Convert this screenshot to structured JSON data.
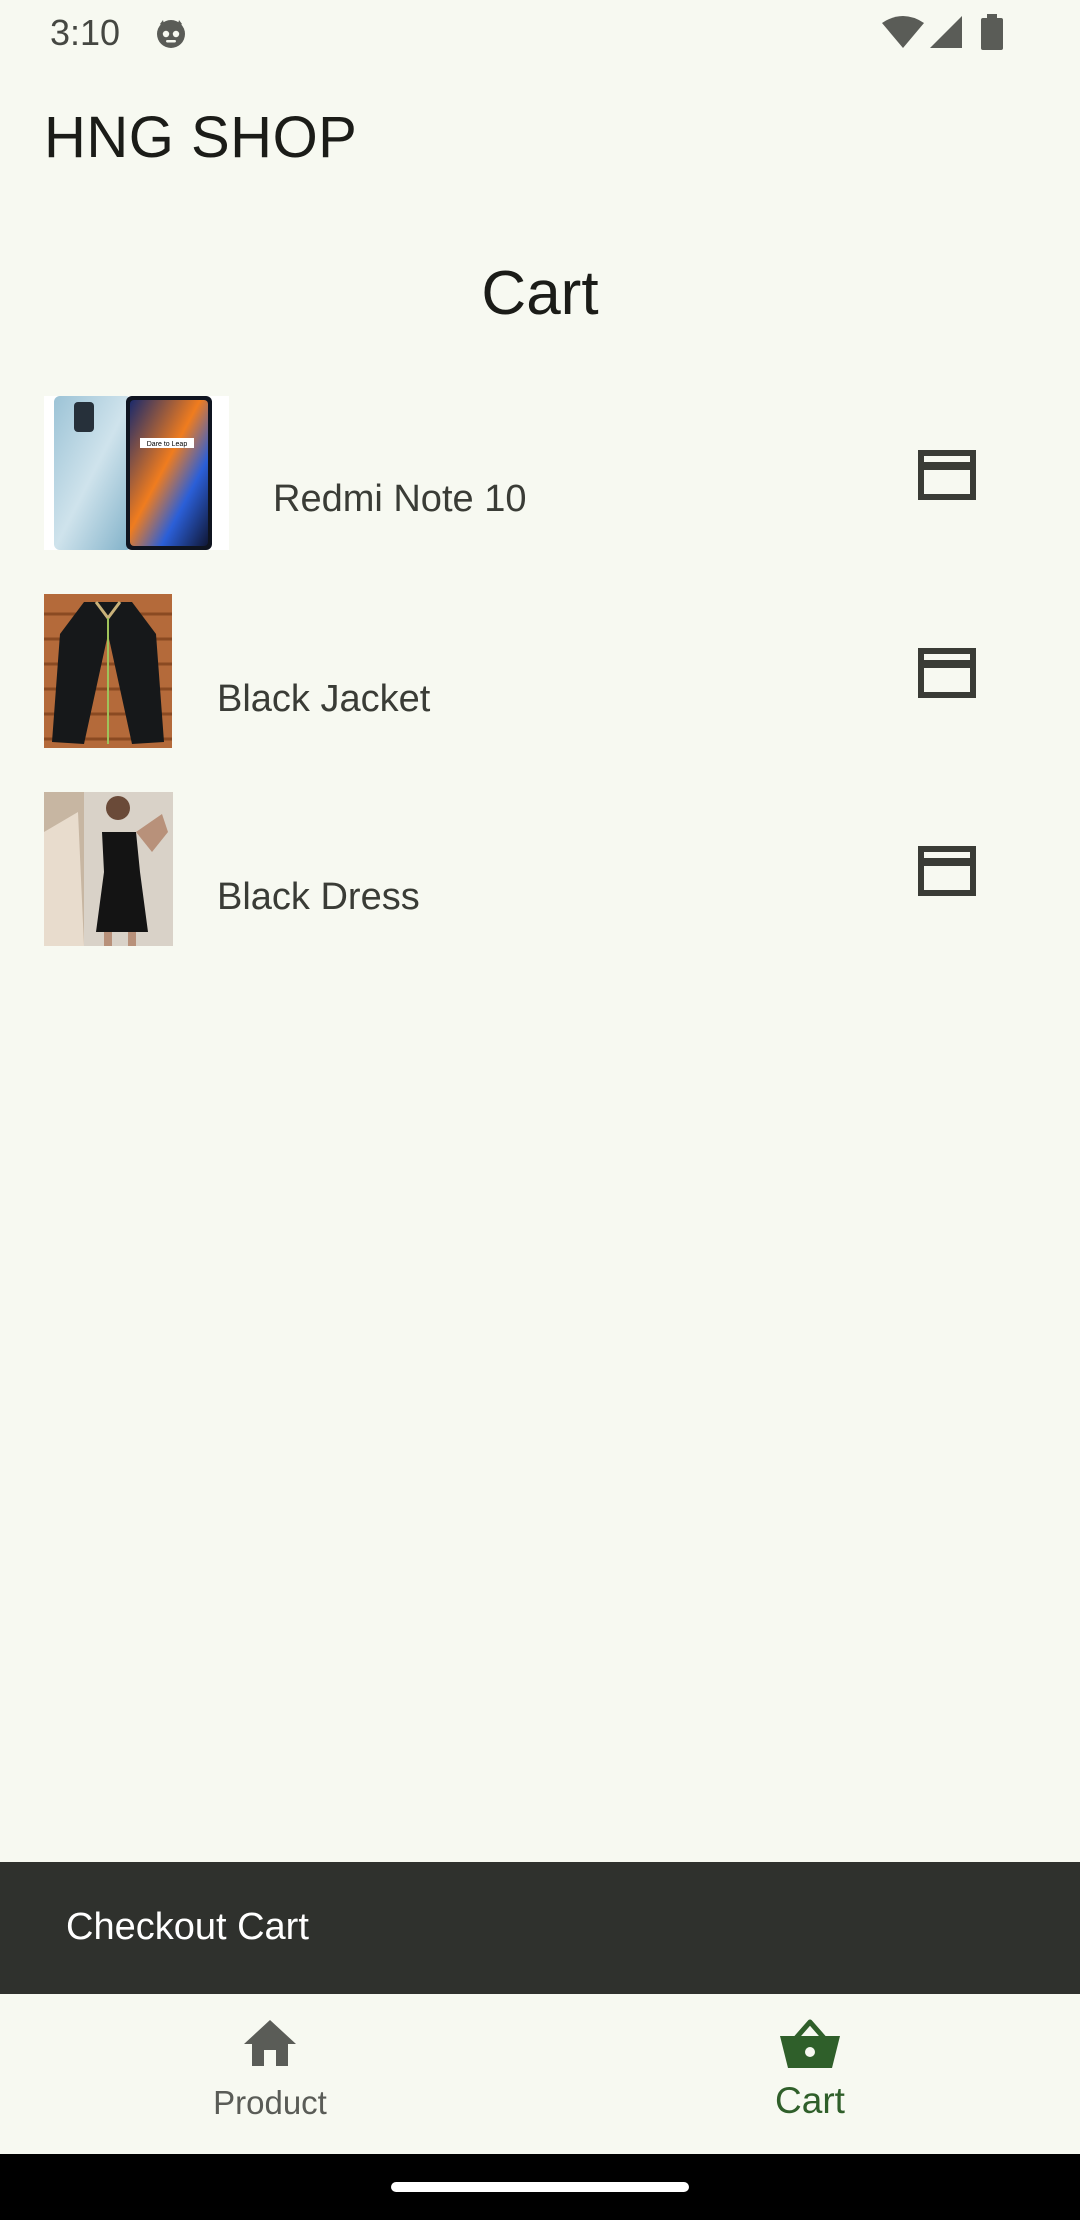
{
  "status_bar": {
    "time": "3:10",
    "icons": [
      "app-notification-icon",
      "wifi-icon",
      "cell-signal-icon",
      "battery-icon"
    ]
  },
  "app_bar": {
    "title": "HNG SHOP"
  },
  "page": {
    "heading": "Cart"
  },
  "cart": {
    "items": [
      {
        "name": "Redmi Note 10",
        "image": "phone-product-image",
        "action_icon": "credit-card-icon"
      },
      {
        "name": "Black Jacket",
        "image": "jacket-product-image",
        "action_icon": "credit-card-icon"
      },
      {
        "name": "Black Dress",
        "image": "dress-product-image",
        "action_icon": "credit-card-icon"
      }
    ]
  },
  "checkout": {
    "label": "Checkout Cart"
  },
  "bottom_nav": {
    "items": [
      {
        "label": "Product",
        "icon": "home-icon",
        "selected": false
      },
      {
        "label": "Cart",
        "icon": "shopping-basket-icon",
        "selected": true
      }
    ]
  },
  "colors": {
    "background": "#f7f9f1",
    "checkout_bar": "#2f312d",
    "nav_selected": "#2f5f2a",
    "nav_unselected": "#5a5c57",
    "text_primary": "#1b1c18"
  }
}
